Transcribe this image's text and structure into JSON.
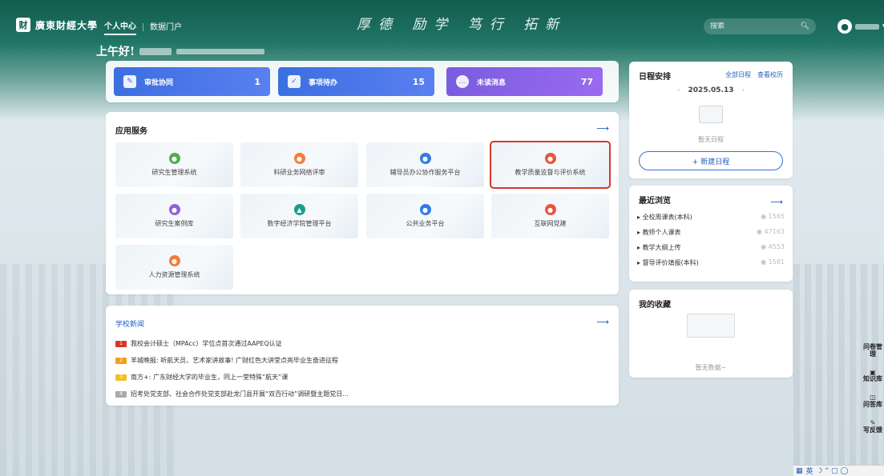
{
  "header": {
    "logo_mark": "财",
    "logo_text": "廣東財經大學",
    "nav": [
      "个人中心",
      "数据门户"
    ],
    "motto": "厚德 励学 笃行 拓新",
    "search_placeholder": "搜索",
    "greeting": "上午好!"
  },
  "stats": [
    {
      "label": "审批协同",
      "value": "1"
    },
    {
      "label": "事项待办",
      "value": "15"
    },
    {
      "label": "未读消息",
      "value": "77"
    }
  ],
  "apps": {
    "title": "应用服务",
    "items": [
      {
        "name": "研究生管理系统",
        "color": "#4caf50"
      },
      {
        "name": "科研业务网络评审",
        "color": "#f57c3a"
      },
      {
        "name": "辅导员办公协作服务平台",
        "color": "#2f7de1"
      },
      {
        "name": "教学质量监督与评价系统",
        "color": "#e8553f"
      },
      {
        "name": "研究生案例库",
        "color": "#8e63d6"
      },
      {
        "name": "数字经济学院管理平台",
        "color": "#1aa088"
      },
      {
        "name": "公共业务平台",
        "color": "#2f7de1"
      },
      {
        "name": "互联网党建",
        "color": "#e8553f"
      },
      {
        "name": "人力资源管理系统",
        "color": "#f57c3a"
      }
    ]
  },
  "news": {
    "title": "学校新闻",
    "items": [
      {
        "tag_color": "#d8362b",
        "text": "我校会计硕士（MPAcc）学位点首次通过AAPEQ认证"
      },
      {
        "tag_color": "#f0a020",
        "text": "羊城晚报: 听航天员、艺术家讲故事! 广财红色大讲堂点亮毕业生奋进征程"
      },
      {
        "tag_color": "#f0c020",
        "text": "南方+: 广东财经大学的毕业生，同上一堂特殊“航天”课"
      },
      {
        "tag_color": "#aaaaaa",
        "text": "招考处党支部、社会合作处党支部赴龙门县开展“双百行动”调研暨主题党日..."
      }
    ]
  },
  "schedule": {
    "title": "日程安排",
    "links": [
      "全部日程",
      "查看校历"
    ],
    "date": "2025.05.13",
    "empty": "暂无日程",
    "new_button": "+ 新建日程"
  },
  "recent": {
    "title": "最近浏览",
    "items": [
      {
        "name": "全校周课表(本科)",
        "count": "1565"
      },
      {
        "name": "教师个人课表",
        "count": "47163"
      },
      {
        "name": "教学大纲上传",
        "count": "4553"
      },
      {
        "name": "督导评价填报(本科)",
        "count": "1581"
      }
    ]
  },
  "favorites": {
    "title": "我的收藏",
    "empty": "暂无数据~"
  },
  "side_tools": [
    "问卷管理",
    "知识库",
    "问答库",
    "写反馈"
  ],
  "ime": "英"
}
